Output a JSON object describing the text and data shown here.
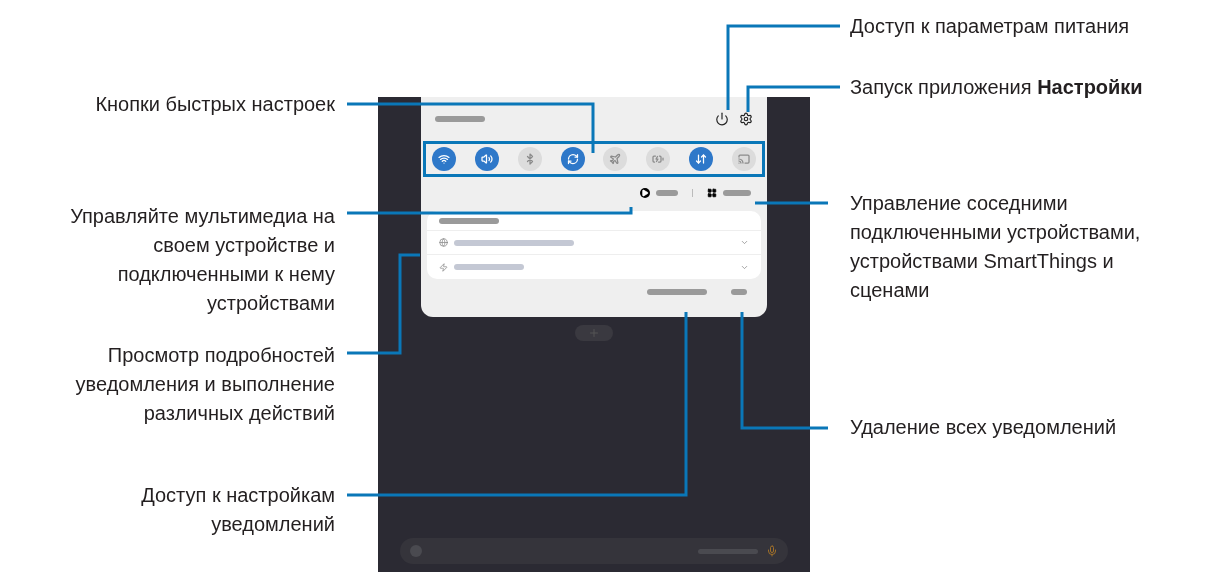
{
  "callouts_right": [
    {
      "lines": [
        "Доступ к параметрам питания"
      ]
    },
    {
      "lines": [
        "Запуск приложения **Настройки**"
      ]
    },
    {
      "lines": [
        "Управление соседними",
        "подключенными устройствами,",
        "устройствами SmartThings и",
        "сценами"
      ]
    },
    {
      "lines": [
        "Удаление всех уведомлений"
      ]
    }
  ],
  "callouts_left": [
    {
      "lines": [
        "Кнопки быстрых настроек"
      ]
    },
    {
      "lines": [
        "Управляйте мультимедиа на",
        "своем устройстве и",
        "подключенными к нему",
        "устройствами"
      ]
    },
    {
      "lines": [
        "Просмотр подробностей",
        "уведомления и выполнение",
        "различных действий"
      ]
    },
    {
      "lines": [
        "Доступ к настройкам",
        "уведомлений"
      ]
    }
  ],
  "quick_buttons": [
    {
      "kind": "wifi",
      "on": true
    },
    {
      "kind": "sound",
      "on": true
    },
    {
      "kind": "bluetooth",
      "on": false
    },
    {
      "kind": "rotate",
      "on": true
    },
    {
      "kind": "airplane",
      "on": false
    },
    {
      "kind": "battery",
      "on": false
    },
    {
      "kind": "data",
      "on": true
    },
    {
      "kind": "share",
      "on": false
    }
  ]
}
